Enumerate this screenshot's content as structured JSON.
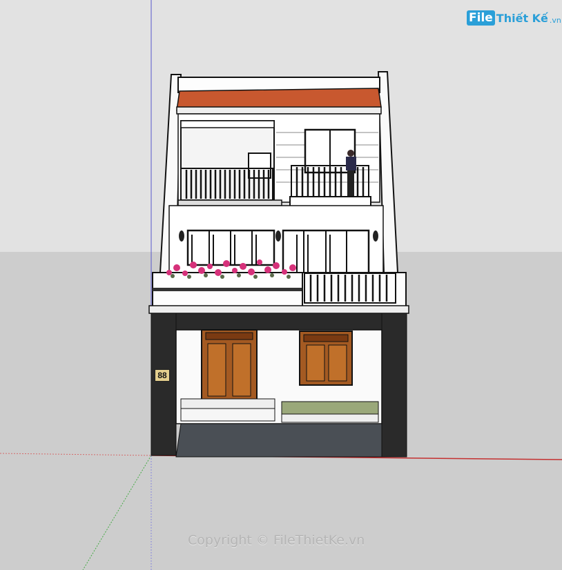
{
  "watermark": {
    "logo_file": "File",
    "logo_rest": "Thiết Kế",
    "logo_tld": ".vn",
    "copyright": "Copyright © FileThietKe.vn"
  },
  "house": {
    "number_plate": "88"
  },
  "colors": {
    "brand": "#2a9fd8",
    "roof_tile": "#c8582f",
    "stone_base": "#2a2a2a",
    "door_wood": "#a45a22",
    "flowers": "#d6317a"
  }
}
